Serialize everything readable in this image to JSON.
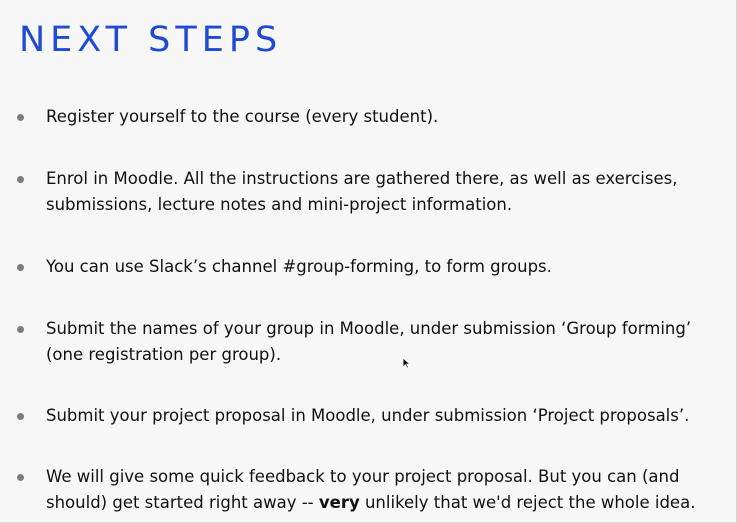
{
  "slide": {
    "title": "NEXT STEPS",
    "bullets": [
      {
        "text": "Register yourself to the course (every student)."
      },
      {
        "text": "Enrol in Moodle. All the instructions are gathered there, as well as exercises,\nsubmissions, lecture notes and mini-project information."
      },
      {
        "text": "You can use Slack’s channel #group-forming, to form groups."
      },
      {
        "text": "Submit the names of your group in Moodle, under submission ‘Group forming’\n(one registration per group)."
      },
      {
        "text": "Submit your project proposal in Moodle, under submission ‘Project proposals’."
      },
      {
        "text_before": "We will give some quick feedback to your project proposal. But you can (and\nshould) get started right away -- ",
        "emphasis": "very",
        "text_after": " unlikely that we'd reject the whole idea."
      }
    ]
  },
  "colors": {
    "title": "#1f4ad6",
    "bullet_dot": "#7c7c7c",
    "text": "#111111",
    "background": "#f7f7f7"
  },
  "icons": {
    "cursor": "mouse-pointer-icon",
    "bullet": "bullet-dot-icon"
  }
}
